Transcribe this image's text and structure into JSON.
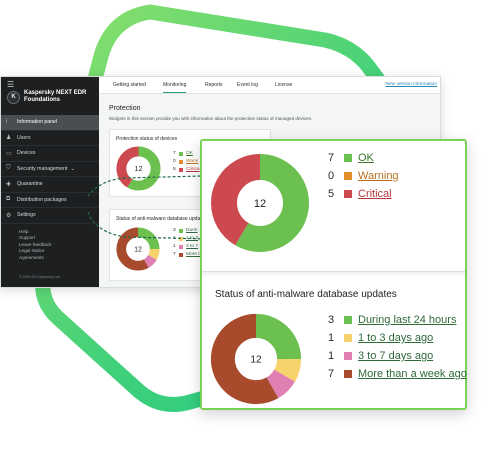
{
  "colors": {
    "ok": "#6cc04f",
    "warning": "#e58c2e",
    "critical": "#cc4a4f",
    "update_24h": "#6cc04f",
    "update_1_3": "#f5d36a",
    "update_3_7": "#df7fb2",
    "update_week": "#a84a2c",
    "link_ok": "#3a7a2a",
    "link_warning": "#b86e1e",
    "link_critical": "#b3363b",
    "link_update": "#2f6a3a",
    "accent": "#29a073",
    "frame_green": "#7bd158"
  },
  "sidebar": {
    "menu_icon": "hamburger-icon",
    "brand": "Kaspersky NEXT EDR Foundations",
    "items": [
      {
        "label": "Information panel",
        "icon": "i",
        "active": true
      },
      {
        "label": "Users",
        "icon": "♟",
        "active": false
      },
      {
        "label": "Devices",
        "icon": "▭",
        "active": false
      },
      {
        "label": "Security management",
        "icon": "⛉",
        "active": false,
        "arrow": "⌄"
      },
      {
        "label": "Quarantine",
        "icon": "✚",
        "active": false
      },
      {
        "label": "Distribution packages",
        "icon": "⧉",
        "active": false
      },
      {
        "label": "Settings",
        "icon": "⚙",
        "active": false
      }
    ],
    "footer_links": [
      "Help",
      "Support",
      "Leave feedback",
      "Legal Notice",
      "Agreements"
    ],
    "copyright": "© 2025 AO Kaspersky Lab"
  },
  "tabs": {
    "items": [
      "Getting started",
      "Monitoring",
      "Reports",
      "Event log",
      "License"
    ],
    "active_index": 1,
    "new_version": "New version information"
  },
  "section": {
    "title": "Protection",
    "description": "Widgets in this section provide you with information about the protection status of managed devices."
  },
  "protection_widget": {
    "title": "Protection status of devices",
    "total": "12",
    "legend": [
      {
        "count": "7",
        "label": "OK",
        "color_key": "ok"
      },
      {
        "count": "0",
        "label": "Warning",
        "color_key": "warning"
      },
      {
        "count": "5",
        "label": "Critical",
        "color_key": "critical"
      }
    ],
    "small_legend_labels": [
      "OK",
      "Warni",
      "Critica"
    ]
  },
  "updates_widget": {
    "title": "Status of anti-malware database updates",
    "small_title": "Status of anti-malware database upda",
    "total": "12",
    "legend": [
      {
        "count": "3",
        "label": "During last 24 hours",
        "color_key": "update_24h"
      },
      {
        "count": "1",
        "label": "1 to 3 days ago",
        "color_key": "update_1_3"
      },
      {
        "count": "1",
        "label": "3 to 7 days ago",
        "color_key": "update_3_7"
      },
      {
        "count": "7",
        "label": "More than a week ago",
        "color_key": "update_week"
      }
    ],
    "small_legend_labels": [
      "Durin",
      "1 to 3",
      "3 to 7",
      "More th"
    ]
  },
  "chart_data": [
    {
      "type": "pie",
      "title": "Protection status of devices",
      "categories": [
        "OK",
        "Warning",
        "Critical"
      ],
      "values": [
        7,
        0,
        5
      ],
      "center_label": "12"
    },
    {
      "type": "pie",
      "title": "Status of anti-malware database updates",
      "categories": [
        "During last 24 hours",
        "1 to 3 days ago",
        "3 to 7 days ago",
        "More than a week ago"
      ],
      "values": [
        3,
        1,
        1,
        7
      ],
      "center_label": "12"
    }
  ]
}
